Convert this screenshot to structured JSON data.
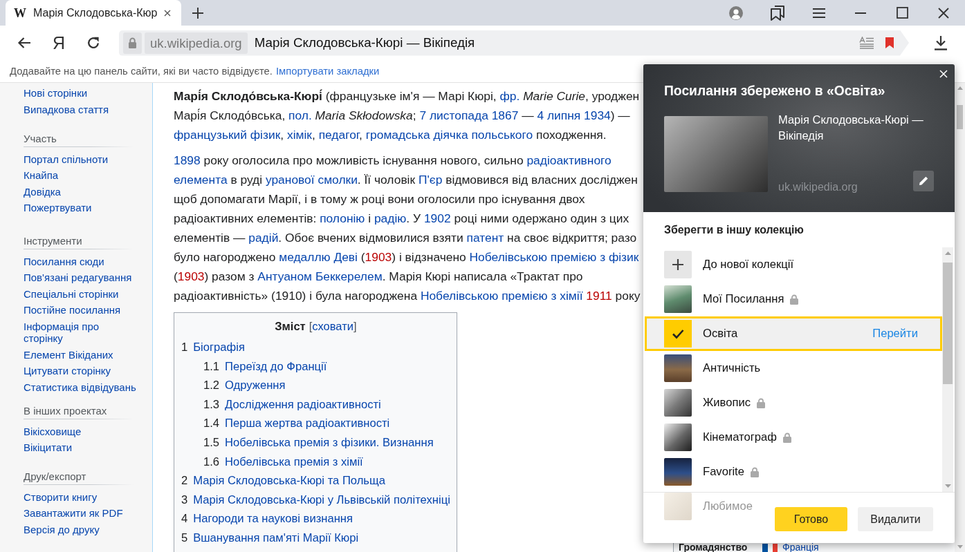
{
  "browser": {
    "tab": {
      "favicon": "W",
      "title": "Марія Склодовська-Кюр",
      "selected": true
    },
    "toolbar": {
      "home_button": "Я"
    },
    "address_bar": {
      "domain": "uk.wikipedia.org",
      "page_title": "Марія Склодовська-Кюрі — Вікіпедія",
      "bookmarked": true
    },
    "bookmarks_bar": {
      "hint": "Додавайте на цю панель сайти, які ви часто відвідуєте.",
      "link": "Імпортувати закладки"
    }
  },
  "sidebar": {
    "sections": [
      {
        "items": [
          "Нові сторінки",
          "Випадкова стаття"
        ]
      },
      {
        "heading": "Участь",
        "items": [
          "Портал спільноти",
          "Кнайпа",
          "Довідка",
          "Пожертвувати"
        ]
      },
      {
        "heading": "Інструменти",
        "items": [
          "Посилання сюди",
          "Пов'язані редагування",
          "Спеціальні сторінки",
          "Постійне посилання",
          "Інформація про сторінку",
          "Елемент Вікіданих",
          "Цитувати сторінку",
          "Статистика відвідувань"
        ]
      },
      {
        "heading": "В інших проектах",
        "items": [
          "Вікісховище",
          "Вікіцитати"
        ]
      },
      {
        "heading": "Друк/експорт",
        "items": [
          "Створити книгу",
          "Завантажити як PDF",
          "Версія до друку"
        ]
      }
    ]
  },
  "article": {
    "paragraphs": [
      {
        "lines": [
          [
            {
              "kind": "text",
              "text": "**Марі́я Склодо́вська-Кюрі́** (французьке ім'я — Марі Кюрі, "
            },
            {
              "kind": "link",
              "text": "фр."
            },
            {
              "kind": "text",
              "text": " *Marie Curie*, уроджен"
            }
          ],
          [
            {
              "kind": "text",
              "text": "Марі́я Склодо́вська, "
            },
            {
              "kind": "link",
              "text": "пол."
            },
            {
              "kind": "text",
              "text": " *Maria Skłodowska*; "
            },
            {
              "kind": "link",
              "text": "7 листопада 1867"
            },
            {
              "kind": "text",
              "text": " — "
            },
            {
              "kind": "link",
              "text": "4 липня 1934"
            },
            {
              "kind": "text",
              "text": ") —"
            }
          ],
          [
            {
              "kind": "link",
              "text": "французький фізик"
            },
            {
              "kind": "text",
              "text": ", "
            },
            {
              "kind": "link",
              "text": "хімік"
            },
            {
              "kind": "text",
              "text": ", "
            },
            {
              "kind": "link",
              "text": "педагог"
            },
            {
              "kind": "text",
              "text": ", "
            },
            {
              "kind": "link",
              "text": "громадська діячка польського"
            },
            {
              "kind": "text",
              "text": " походження."
            }
          ]
        ]
      },
      {
        "lines": [
          [
            {
              "kind": "link",
              "text": "1898"
            },
            {
              "kind": "text",
              "text": " року оголосила про можливість існування нового, сильно "
            },
            {
              "kind": "link",
              "text": "радіоактивного"
            }
          ],
          [
            {
              "kind": "link",
              "text": "елемента"
            },
            {
              "kind": "text",
              "text": " в руді "
            },
            {
              "kind": "link",
              "text": "уранової смолки"
            },
            {
              "kind": "text",
              "text": ". Її чоловік "
            },
            {
              "kind": "link",
              "text": "П'єр"
            },
            {
              "kind": "text",
              "text": " відмовився від власних досліджен"
            }
          ],
          [
            {
              "kind": "text",
              "text": "щоб допомагати Марії, і в тому ж році вони оголосили про існування двох"
            }
          ],
          [
            {
              "kind": "text",
              "text": "радіоактивних елементів: "
            },
            {
              "kind": "link",
              "text": "полонію"
            },
            {
              "kind": "text",
              "text": " і "
            },
            {
              "kind": "link",
              "text": "радію"
            },
            {
              "kind": "text",
              "text": ". У "
            },
            {
              "kind": "link",
              "text": "1902"
            },
            {
              "kind": "text",
              "text": " році ними одержано один з цих"
            }
          ],
          [
            {
              "kind": "text",
              "text": "елементів — "
            },
            {
              "kind": "link",
              "text": "радій"
            },
            {
              "kind": "text",
              "text": ". Обоє вчених відмовилися взяти "
            },
            {
              "kind": "link",
              "text": "патент"
            },
            {
              "kind": "text",
              "text": " на своє відкриття; разо"
            }
          ],
          [
            {
              "kind": "text",
              "text": "було нагороджено "
            },
            {
              "kind": "link",
              "text": "медаллю Деві"
            },
            {
              "kind": "text",
              "text": " ("
            },
            {
              "kind": "redlink",
              "text": "1903"
            },
            {
              "kind": "text",
              "text": ") і відзначено "
            },
            {
              "kind": "link",
              "text": "Нобелівською премією з фізик"
            }
          ],
          [
            {
              "kind": "text",
              "text": "("
            },
            {
              "kind": "redlink",
              "text": "1903"
            },
            {
              "kind": "text",
              "text": ") разом з "
            },
            {
              "kind": "link",
              "text": "Антуаном Беккерелем"
            },
            {
              "kind": "text",
              "text": ". Марія Кюрі написала «Трактат про"
            }
          ],
          [
            {
              "kind": "text",
              "text": "радіоактивність» (1910) і була нагороджена "
            },
            {
              "kind": "link",
              "text": "Нобелівською премією з хімії"
            },
            {
              "kind": "redlink",
              "text": "1911"
            },
            {
              "kind": "text",
              "text": " року"
            }
          ]
        ]
      }
    ]
  },
  "toc": {
    "title": "Зміст",
    "toggle": {
      "before": "[",
      "label": "сховати",
      "after": "]"
    },
    "items": [
      {
        "number": "1",
        "label": "Біографія",
        "children": [
          {
            "number": "1.1",
            "label": "Переїзд до Франції"
          },
          {
            "number": "1.2",
            "label": "Одруження"
          },
          {
            "number": "1.3",
            "label": "Дослідження радіоактивності"
          },
          {
            "number": "1.4",
            "label": "Перша жертва радіоактивності"
          },
          {
            "number": "1.5",
            "label": "Нобелівська премія з фізики. Визнання"
          },
          {
            "number": "1.6",
            "label": "Нобелівська премія з хімії"
          }
        ]
      },
      {
        "number": "2",
        "label": "Марія Склодовська-Кюрі та Польща"
      },
      {
        "number": "3",
        "label": "Марія Склодовська-Кюрі у Львівській політехніці"
      },
      {
        "number": "4",
        "label": "Нагороди та наукові визнання"
      },
      {
        "number": "5",
        "label": "Вшанування пам'яті Марії Кюрі"
      }
    ]
  },
  "infobox_row": {
    "label": "Громадянство",
    "value": "Франція"
  },
  "popup": {
    "title": "Посилання збережено в «Освіта»",
    "page": {
      "title": "Марія Склодовська-Кюрі — Вікіпедія",
      "domain": "uk.wikipedia.org"
    },
    "section_title": "Зберегти в іншу колекцію",
    "collections": [
      {
        "kind": "new",
        "label": "До нової колекції",
        "locked": false,
        "selected": false,
        "faded": false
      },
      {
        "kind": "collection",
        "label": "Мої Посилання",
        "locked": true,
        "selected": false,
        "faded": false
      },
      {
        "kind": "collection",
        "label": "Освіта",
        "locked": false,
        "selected": true,
        "faded": false,
        "action": "Перейти"
      },
      {
        "kind": "collection",
        "label": "Античність",
        "locked": false,
        "selected": false,
        "faded": false
      },
      {
        "kind": "collection",
        "label": "Живопис",
        "locked": true,
        "selected": false,
        "faded": false
      },
      {
        "kind": "collection",
        "label": "Кінематограф",
        "locked": true,
        "selected": false,
        "faded": false
      },
      {
        "kind": "collection",
        "label": "Favorite",
        "locked": true,
        "selected": false,
        "faded": false
      },
      {
        "kind": "collection",
        "label": "Любимое",
        "locked": false,
        "selected": false,
        "faded": true
      }
    ],
    "buttons": [
      {
        "kind": "confirm",
        "label": "Готово"
      },
      {
        "kind": "delete",
        "label": "Видалити"
      }
    ]
  }
}
